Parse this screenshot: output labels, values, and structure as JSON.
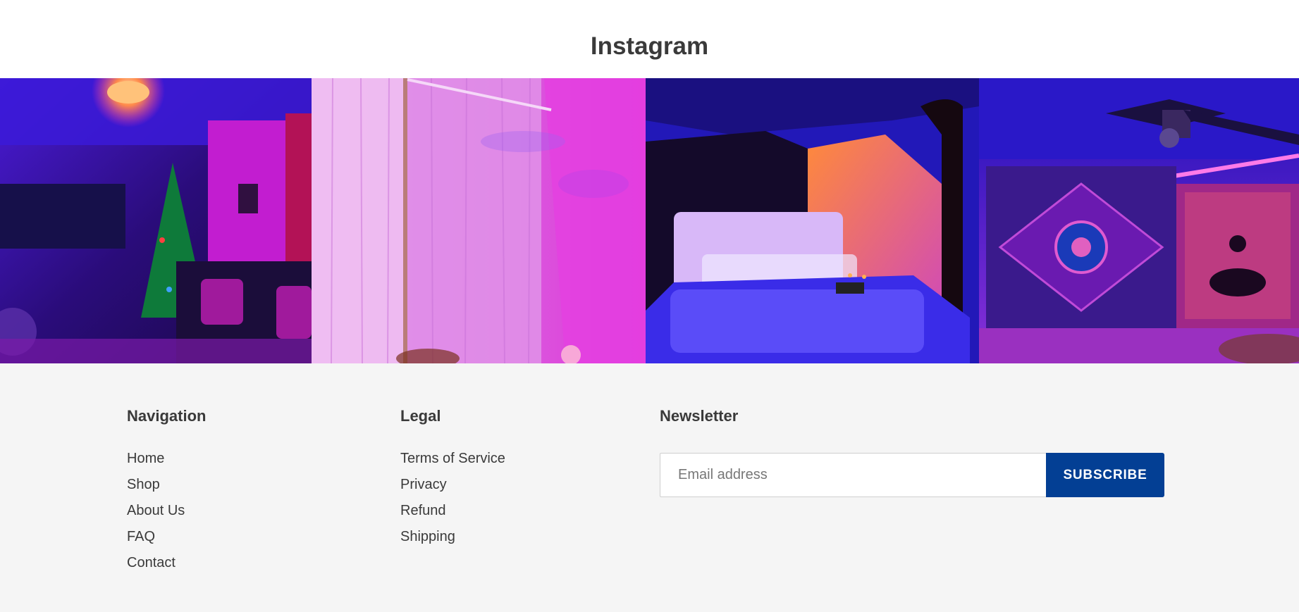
{
  "instagram": {
    "title": "Instagram",
    "photos": [
      {
        "icon": "photo-living-room-christmas-tree"
      },
      {
        "icon": "photo-pink-curtains"
      },
      {
        "icon": "photo-bedroom-galaxy-ceiling"
      },
      {
        "icon": "photo-tapestry-wall"
      }
    ]
  },
  "footer": {
    "navigation": {
      "heading": "Navigation",
      "links": [
        "Home",
        "Shop",
        "About Us",
        "FAQ",
        "Contact"
      ]
    },
    "legal": {
      "heading": "Legal",
      "links": [
        "Terms of Service",
        "Privacy",
        "Refund",
        "Shipping"
      ]
    },
    "newsletter": {
      "heading": "Newsletter",
      "email_placeholder": "Email address",
      "email_value": "",
      "subscribe_label": "SUBSCRIBE"
    }
  },
  "colors": {
    "background": "#ffffff",
    "footer_background": "#f5f5f5",
    "text": "#3a3a3a",
    "accent_button": "#033f94",
    "button_text": "#ffffff"
  }
}
